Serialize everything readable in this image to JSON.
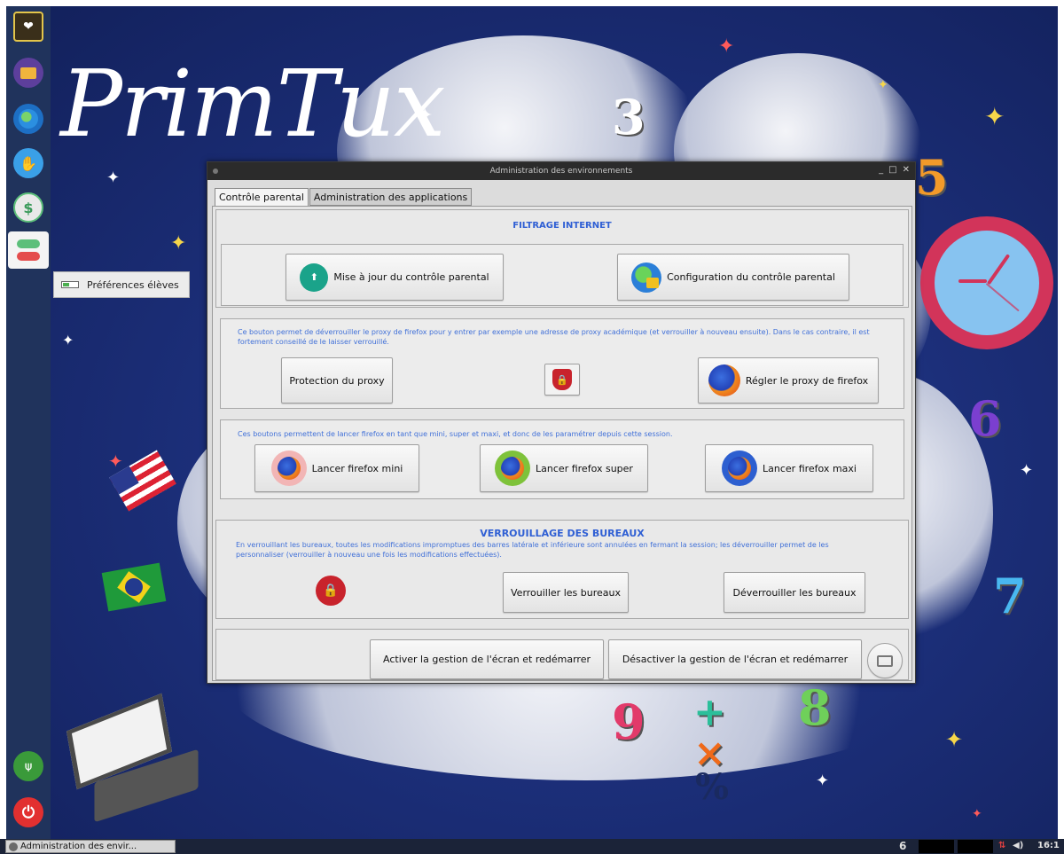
{
  "desktop": {
    "logo_text": "PrimTux",
    "numbers": [
      "3",
      "5",
      "6",
      "7",
      "8",
      "9"
    ],
    "math_symbols": [
      "+",
      "×",
      "%"
    ]
  },
  "dock": {
    "items": [
      {
        "name": "primtux-menu-icon",
        "color": "#e3c54a"
      },
      {
        "name": "folder-icon",
        "color": "#f0b43c"
      },
      {
        "name": "globe-icon",
        "color": "#2b8fe0"
      },
      {
        "name": "hands-icon",
        "color": "#3aa0e8"
      },
      {
        "name": "dollar-icon",
        "color": "#5cbf7a"
      },
      {
        "name": "toggle-preferences-icon",
        "color": "#e44c4c"
      }
    ],
    "tooltip": "Préférences élèves",
    "network_icon": "antenna-icon",
    "power_icon": "power-icon"
  },
  "window": {
    "title": "Administration des environnements",
    "tabs": [
      {
        "label": "Contrôle parental",
        "active": true
      },
      {
        "label": "Administration des applications",
        "active": false
      }
    ],
    "filtrage": {
      "heading": "FILTRAGE INTERNET",
      "update_button": "Mise à jour du contrôle parental",
      "config_button": "Configuration du contrôle parental"
    },
    "proxy": {
      "description": "Ce bouton permet de déverrouiller le proxy de firefox pour y entrer par exemple une adresse de proxy académique (et verrouiller à nouveau ensuite). Dans le cas contraire, il est fortement conseillé de le laisser verrouillé.",
      "protection_button": "Protection du proxy",
      "settings_button": "Régler le proxy de firefox"
    },
    "firefox": {
      "description": "Ces boutons permettent de lancer firefox en tant que mini, super et maxi, et donc de les paramétrer depuis cette session.",
      "mini_button": "Lancer firefox mini",
      "super_button": "Lancer firefox super",
      "maxi_button": "Lancer firefox maxi"
    },
    "lock": {
      "heading": "VERROUILLAGE DES BUREAUX",
      "description": "En verrouillant les bureaux, toutes les modifications impromptues des barres latérale et inférieure sont annulées en fermant la session; les déverrouiller permet de les personnaliser (verrouiller à nouveau une fois les modifications effectuées).",
      "lock_button": "Verrouiller les bureaux",
      "unlock_button": "Déverrouiller les bureaux"
    },
    "screen": {
      "activate_button": "Activer la gestion de l'écran et redémarrer",
      "deactivate_button": "Désactiver la gestion de l'écran et redémarrer"
    }
  },
  "taskbar": {
    "task_label": "Administration des envir...",
    "workspace": "6",
    "clock": "16:1"
  }
}
